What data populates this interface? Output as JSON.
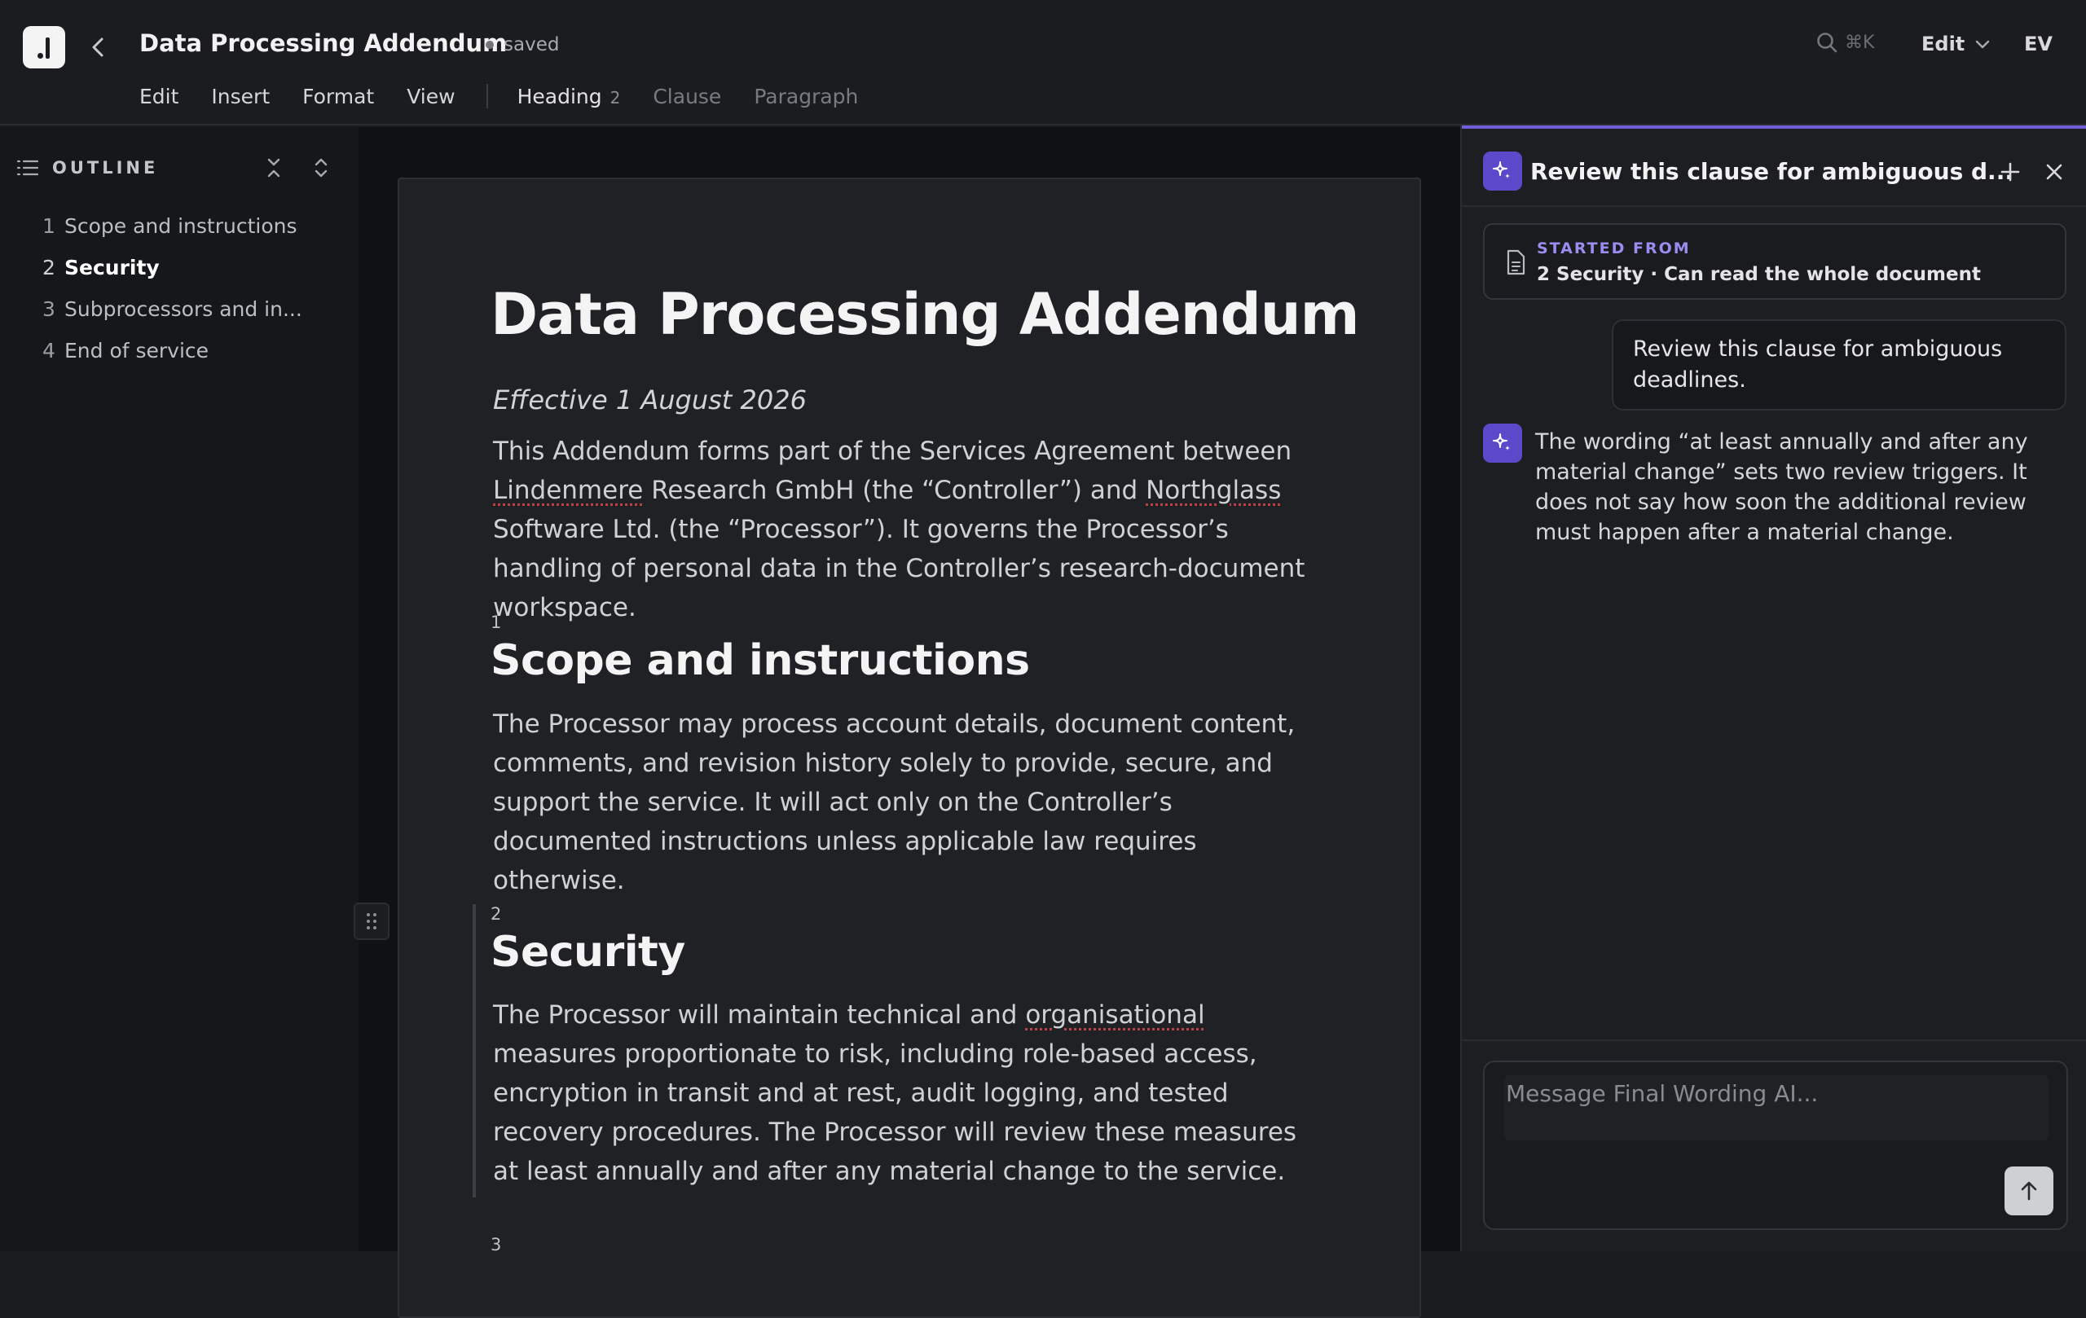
{
  "app": {
    "doc_title": "Data Processing Addendum",
    "save_status": "saved",
    "search_shortcut": "⌘K",
    "mode_label": "Edit",
    "user_initials": "EV"
  },
  "menus": [
    "Edit",
    "Insert",
    "Format",
    "View"
  ],
  "format_bar": {
    "heading_label": "Heading",
    "heading_level": "2",
    "clause_label": "Clause",
    "paragraph_label": "Paragraph"
  },
  "outline": {
    "title": "OUTLINE",
    "items": [
      {
        "num": "1",
        "label": "Scope and instructions"
      },
      {
        "num": "2",
        "label": "Security"
      },
      {
        "num": "3",
        "label": "Subprocessors and in..."
      },
      {
        "num": "4",
        "label": "End of service"
      }
    ],
    "active_index": 1
  },
  "document": {
    "title": "Data Processing Addendum",
    "effective": "Effective 1 August 2026",
    "intro": {
      "p1": "This Addendum forms part of the Services Agreement between ",
      "controller_name": "Lindenmere",
      "p2": " Research GmbH (the “Controller”) and ",
      "processor_name": "Northglass",
      "p3": " Software Ltd. (the “Processor”). It governs the Processor’s handling of personal data in the Controller’s research-document workspace."
    },
    "sections": [
      {
        "num": "1",
        "heading": "Scope and instructions",
        "body": "The Processor may process account details, document content, comments, and revision history solely to provide, secure, and support the service. It will act only on the Controller’s documented instructions unless applicable law requires otherwise."
      },
      {
        "num": "2",
        "heading": "Security",
        "body_a": "The Processor will maintain technical and ",
        "body_flagged": "organisational",
        "body_b": " measures proportionate to risk, including role-based access, encryption in transit and at rest, audit logging, and tested recovery procedures. The Processor will review these measures at least annually and after any material change to the service."
      },
      {
        "num": "3"
      }
    ]
  },
  "assistant": {
    "thread_title": "Review this clause for ambiguous d...",
    "started_from_label": "STARTED FROM",
    "started_from_context": "2 Security · Can read the whole document",
    "user_message": "Review this clause for ambiguous deadlines.",
    "ai_message": "The wording “at least annually and after any material change” sets two review triggers. It does not say how soon the additional review must happen after a material change.",
    "composer_placeholder": "Message Final Wording AI..."
  },
  "colors": {
    "accent": "#5a49c9",
    "accent_text": "#9a8cf0",
    "spellcheck": "#c0404a",
    "background": "#1b1c1f"
  }
}
